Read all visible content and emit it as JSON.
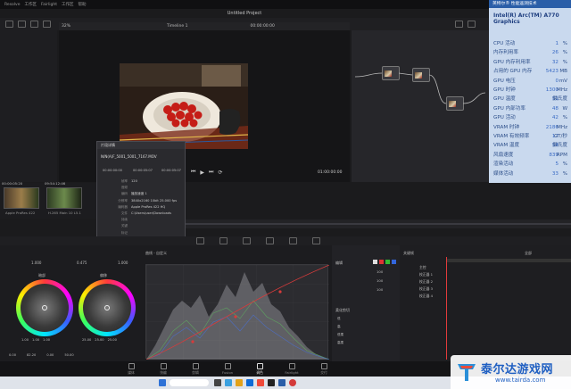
{
  "menubar": {
    "items": [
      "Resolve",
      "工作区",
      "Fairlight",
      "工作区",
      "帮助"
    ]
  },
  "app_title": "Untitled Project",
  "viewer": {
    "zoom": "32%",
    "timeline_label": "Timeline 1",
    "timecode_top": "00:00:00:00",
    "timecode_bottom": "01:00:00:00",
    "clip_timecodes": [
      "00:00:00:00",
      "00:00:05:07"
    ]
  },
  "dialog": {
    "title": "片段详情",
    "filename": "N/N(A)F_5001_5001_7167.MOV",
    "tc_in": "00:00:00:00",
    "tc_out": "00:00:05:07",
    "tc_dur": "00:00:05:07",
    "rows": [
      {
        "label": "帧率",
        "value": "120"
      },
      {
        "label": "音频",
        "value": ""
      },
      {
        "label": "编码",
        "value": "播放速度 1"
      },
      {
        "label": "分辨率",
        "value": "3840x2160 10bit 25.000 fps"
      },
      {
        "label": "编码器",
        "value": "Apple ProRes 422 HQ"
      },
      {
        "label": "文件",
        "value": "C:\\Users\\user\\Downloads"
      },
      {
        "label": "持续",
        "value": ""
      },
      {
        "label": "关键",
        "value": ""
      },
      {
        "label": "标记",
        "value": ""
      }
    ]
  },
  "clips": [
    {
      "tc": "00:00:05:20",
      "name": "Apple ProRes 422"
    },
    {
      "tc": "09:54:12:46",
      "name": "H.265 Main 10 L5.1"
    }
  ],
  "color_page": {
    "values": [
      "1.000",
      "0.475",
      "1.000"
    ],
    "wheels": [
      {
        "name": "暗部",
        "vals": [
          "1.00",
          "1.00",
          "1.00"
        ]
      },
      {
        "name": "偏移",
        "vals": [
          "25.00",
          "25.00",
          "25.00"
        ]
      }
    ],
    "bottom_values": [
      "0.00",
      "82.20",
      "0.00",
      "50.00"
    ],
    "curve_label": "曲线 - 自定义",
    "node_props_title": "编辑",
    "node_values": [
      "100",
      "100",
      "100"
    ],
    "soft_clip_title": "柔化剪切",
    "soft_clip_rows": [
      "低",
      "高",
      "低柔",
      "高柔"
    ],
    "keyframes_title": "关键帧",
    "keyframes_rows": [
      "主控",
      "校正器 1",
      "校正器 2",
      "校正器 3",
      "校正器 4"
    ],
    "keyframe_selector": "全部"
  },
  "pages": [
    "媒体",
    "快编",
    "剪辑",
    "Fusion",
    "调色",
    "Fairlight",
    "交付"
  ],
  "gpu_monitor": {
    "header": "英特尔® 性能遥测技术",
    "device": "Intel(R) Arc(TM) A770 Graphics",
    "metrics": [
      {
        "key": "CPU 活动",
        "value": "1",
        "unit": "%"
      },
      {
        "key": "内存利用率",
        "value": "26",
        "unit": "%"
      },
      {
        "key": "GPU 内存利用率",
        "value": "32",
        "unit": "%"
      },
      {
        "key": "占用的 GPU 内存",
        "value": "5423",
        "unit": "MB"
      },
      {
        "key": "GPU 电压",
        "value": "0",
        "unit": "mV"
      },
      {
        "key": "GPU 时钟",
        "value": "1300",
        "unit": "MHz"
      },
      {
        "key": "GPU 温度",
        "value": "51",
        "unit": "摄氏度"
      },
      {
        "key": "GPU 内部功率",
        "value": "48",
        "unit": "W"
      },
      {
        "key": "GPU 活动",
        "value": "42",
        "unit": "%"
      },
      {
        "key": "VRAM 时钟",
        "value": "2186",
        "unit": "MHz"
      },
      {
        "key": "VRAM 有效频率",
        "value": "17",
        "unit": "GT/秒"
      },
      {
        "key": "VRAM 温度",
        "value": "54",
        "unit": "摄氏度"
      },
      {
        "key": "风扇速度",
        "value": "839",
        "unit": "RPM"
      },
      {
        "key": "渲染活动",
        "value": "5",
        "unit": "%"
      },
      {
        "key": "媒体活动",
        "value": "33",
        "unit": "%"
      }
    ]
  },
  "watermark": {
    "title": "泰尔达游戏网",
    "url": "www.tairda.com"
  }
}
